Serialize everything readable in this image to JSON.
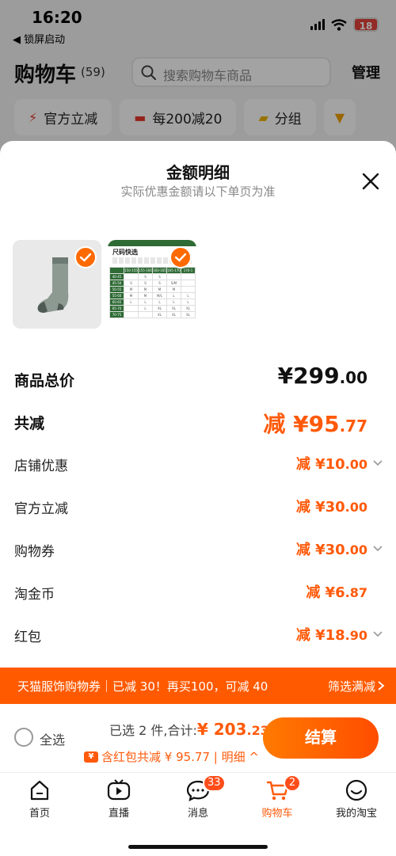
{
  "status_bar": {
    "time": "16:20",
    "back_label": "◀ 锁屏启动",
    "battery": "18"
  },
  "cart_header": {
    "title": "购物车",
    "count": "(59)",
    "search_placeholder": "搜索购物车商品",
    "manage_label": "管理"
  },
  "filter_chips": [
    {
      "label": "官方立减",
      "icon": "lightning-icon"
    },
    {
      "label": "每200减20",
      "icon": "coupon-icon"
    },
    {
      "label": "分组",
      "icon": "folder-icon"
    }
  ],
  "sheet": {
    "title": "金额明细",
    "subtitle": "实际优惠金额请以下单页为准",
    "size_chart_title": "尺码快选",
    "size_chart": {
      "header": [
        "",
        "150-155",
        "155-160",
        "160-165",
        "165-170",
        "170-1"
      ],
      "rows": [
        [
          "40-45",
          "",
          "S",
          "S",
          "",
          ""
        ],
        [
          "45-50",
          "S",
          "S",
          "S",
          "S/M",
          ""
        ],
        [
          "50-55",
          "M",
          "M",
          "M",
          "M",
          ""
        ],
        [
          "55-60",
          "M",
          "M",
          "M/L",
          "L",
          "L"
        ],
        [
          "60-65",
          "L",
          "L",
          "L",
          "L",
          "L"
        ],
        [
          "65-70",
          "",
          "L",
          "XL",
          "XL",
          "XL"
        ],
        [
          "70-75",
          "",
          "",
          "XL",
          "XL",
          "XL"
        ]
      ]
    },
    "total_label": "商品总价",
    "total_int": "¥299",
    "total_dec": ".00",
    "saved_label": "共减",
    "saved_int": "减 ¥95",
    "saved_dec": ".77",
    "discounts": [
      {
        "label": "店铺优惠",
        "int": "减 ¥10",
        "dec": ".00",
        "expandable": true
      },
      {
        "label": "官方立减",
        "int": "减 ¥30",
        "dec": ".00",
        "expandable": false
      },
      {
        "label": "购物券",
        "int": "减 ¥30",
        "dec": ".00",
        "expandable": true
      },
      {
        "label": "淘金币",
        "int": "减 ¥6",
        "dec": ".87",
        "expandable": false
      },
      {
        "label": "红包",
        "int": "减 ¥18",
        "dec": ".90",
        "expandable": true
      }
    ]
  },
  "promo_banner": {
    "text": "天猫服饰购物券｜已减 30！再买100，可减 40",
    "link": "筛选满减"
  },
  "checkout": {
    "select_all": "全选",
    "chosen_prefix": "已选 2 件,合计:",
    "sum_int": "¥ 203",
    "sum_dec": ".23",
    "redpack_text": "含红包共减 ¥ 95.77 | 明细 ^",
    "pay_label": "结算"
  },
  "tabbar": [
    {
      "label": "首页",
      "icon": "home-icon",
      "badge": ""
    },
    {
      "label": "直播",
      "icon": "live-icon",
      "badge": ""
    },
    {
      "label": "消息",
      "icon": "message-icon",
      "badge": "33"
    },
    {
      "label": "购物车",
      "icon": "cart-icon",
      "badge": "2"
    },
    {
      "label": "我的淘宝",
      "icon": "profile-icon",
      "badge": ""
    }
  ],
  "colors": {
    "accent": "#ff5a0a",
    "promo": "#ff5a00",
    "check": "#ff6a00"
  }
}
